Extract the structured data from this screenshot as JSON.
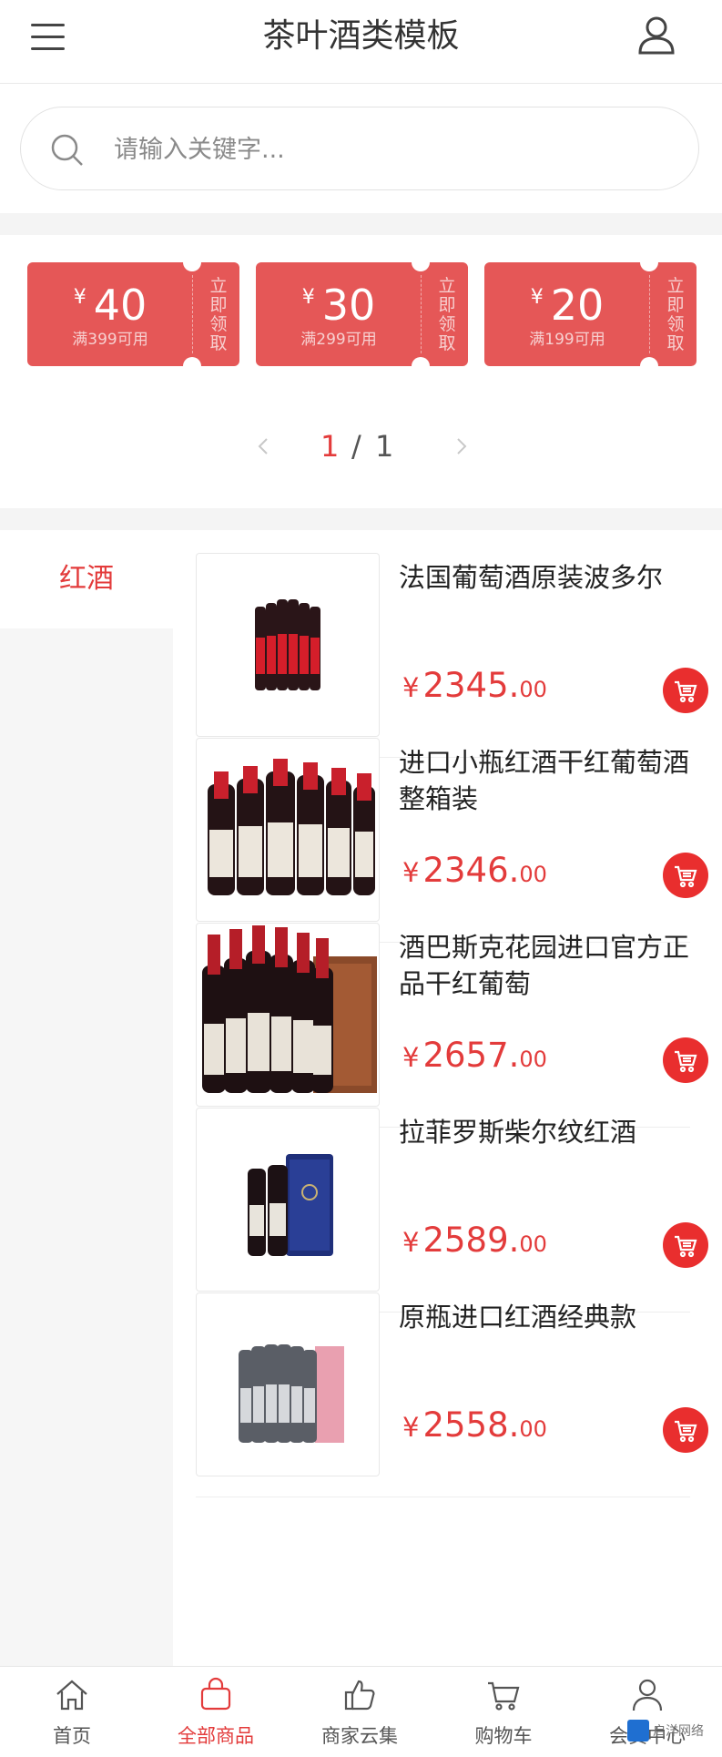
{
  "header": {
    "title": "茶叶酒类模板"
  },
  "search": {
    "placeholder": "请输入关键字..."
  },
  "coupons": [
    {
      "symbol": "¥",
      "amount": "40",
      "condition": "满399可用",
      "action": "立即领取"
    },
    {
      "symbol": "¥",
      "amount": "30",
      "condition": "满299可用",
      "action": "立即领取"
    },
    {
      "symbol": "¥",
      "amount": "20",
      "condition": "满199可用",
      "action": "立即领取"
    }
  ],
  "pager": {
    "current": "1",
    "separator": "/",
    "total": "1"
  },
  "categories": [
    {
      "label": "红酒",
      "active": true
    }
  ],
  "products": [
    {
      "name": "法国葡萄酒原装波多尔",
      "symbol": "¥",
      "price_int": "2345.",
      "price_dec": "00",
      "image": "wine-6-bottles-red-labels"
    },
    {
      "name": "进口小瓶红酒干红葡萄酒整箱装",
      "symbol": "¥",
      "price_int": "2346.",
      "price_dec": "00",
      "image": "wine-6-small-bottles"
    },
    {
      "name": "酒巴斯克花园进口官方正品干红葡萄",
      "symbol": "¥",
      "price_int": "2657.",
      "price_dec": "00",
      "image": "wine-6-bottles-wooden-box"
    },
    {
      "name": "拉菲罗斯柴尔纹红酒",
      "symbol": "¥",
      "price_int": "2589.",
      "price_dec": "00",
      "image": "wine-2-bottles-blue-box"
    },
    {
      "name": "原瓶进口红酒经典款",
      "symbol": "¥",
      "price_int": "2558.",
      "price_dec": "00",
      "image": "wine-6-bottles-pink-box"
    }
  ],
  "tabbar": [
    {
      "label": "首页",
      "icon": "home-icon",
      "active": false
    },
    {
      "label": "全部商品",
      "icon": "bag-icon",
      "active": true
    },
    {
      "label": "商家云集",
      "icon": "thumbs-up-icon",
      "active": false
    },
    {
      "label": "购物车",
      "icon": "cart-icon",
      "active": false
    },
    {
      "label": "会员中心",
      "icon": "user-icon",
      "active": false
    }
  ],
  "watermark": {
    "text": "启洋网络"
  },
  "colors": {
    "accent": "#e33b3b",
    "coupon": "#e55757",
    "cart_button": "#e92e2e"
  }
}
